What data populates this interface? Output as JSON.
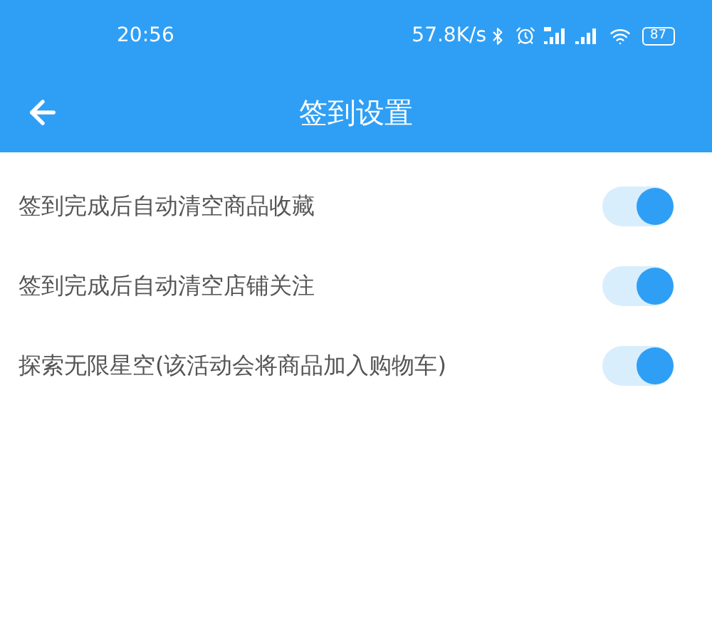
{
  "status_bar": {
    "time": "20:56",
    "speed": "57.8K/s",
    "battery": "87"
  },
  "header": {
    "title": "签到设置"
  },
  "settings": [
    {
      "label": "签到完成后自动清空商品收藏",
      "on": true
    },
    {
      "label": "签到完成后自动清空店铺关注",
      "on": true
    },
    {
      "label": "探索无限星空(该活动会将商品加入购物车)",
      "on": true
    }
  ]
}
